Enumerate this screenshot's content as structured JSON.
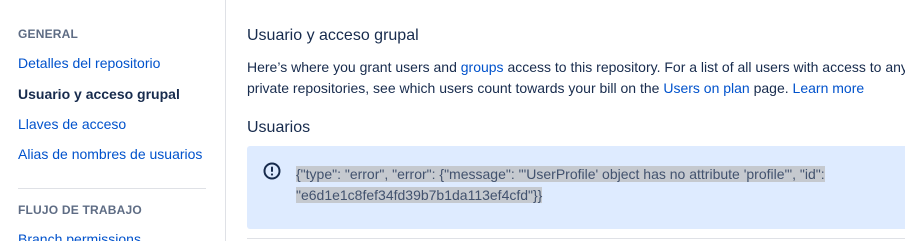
{
  "sidebar": {
    "general_heading": "GENERAL",
    "items": [
      {
        "label": "Detalles del repositorio"
      },
      {
        "label": "Usuario y acceso grupal"
      },
      {
        "label": "Llaves de acceso"
      },
      {
        "label": "Alias de nombres de usuarios"
      }
    ],
    "workflow_heading": "FLUJO DE TRABAJO",
    "workflow_items": [
      {
        "label": "Branch permissions"
      }
    ]
  },
  "main": {
    "title": "Usuario y acceso grupal",
    "desc": {
      "part1": "Here’s where you grant users and ",
      "groups_link": "groups",
      "part2": " access to this repository. For a list of all users with access to any of",
      "part3": "private repositories, see which users count towards your bill on the ",
      "users_on_plan_link": "Users on plan",
      "part4": " page. ",
      "learn_more_link": "Learn more"
    },
    "users_heading": "Usuarios",
    "error": {
      "icon": "info-icon",
      "line1": "{\"type\": \"error\", \"error\": {\"message\": \"'UserProfile' object has no attribute 'profile'\", \"id\":",
      "line2": "\"e6d1e1c8fef34fd39b7b1da113ef4cfd\"}}"
    }
  },
  "colors": {
    "link": "#0052cc",
    "text": "#172b4d",
    "info_bg": "#deebff",
    "info_icon": "#172b4d"
  }
}
